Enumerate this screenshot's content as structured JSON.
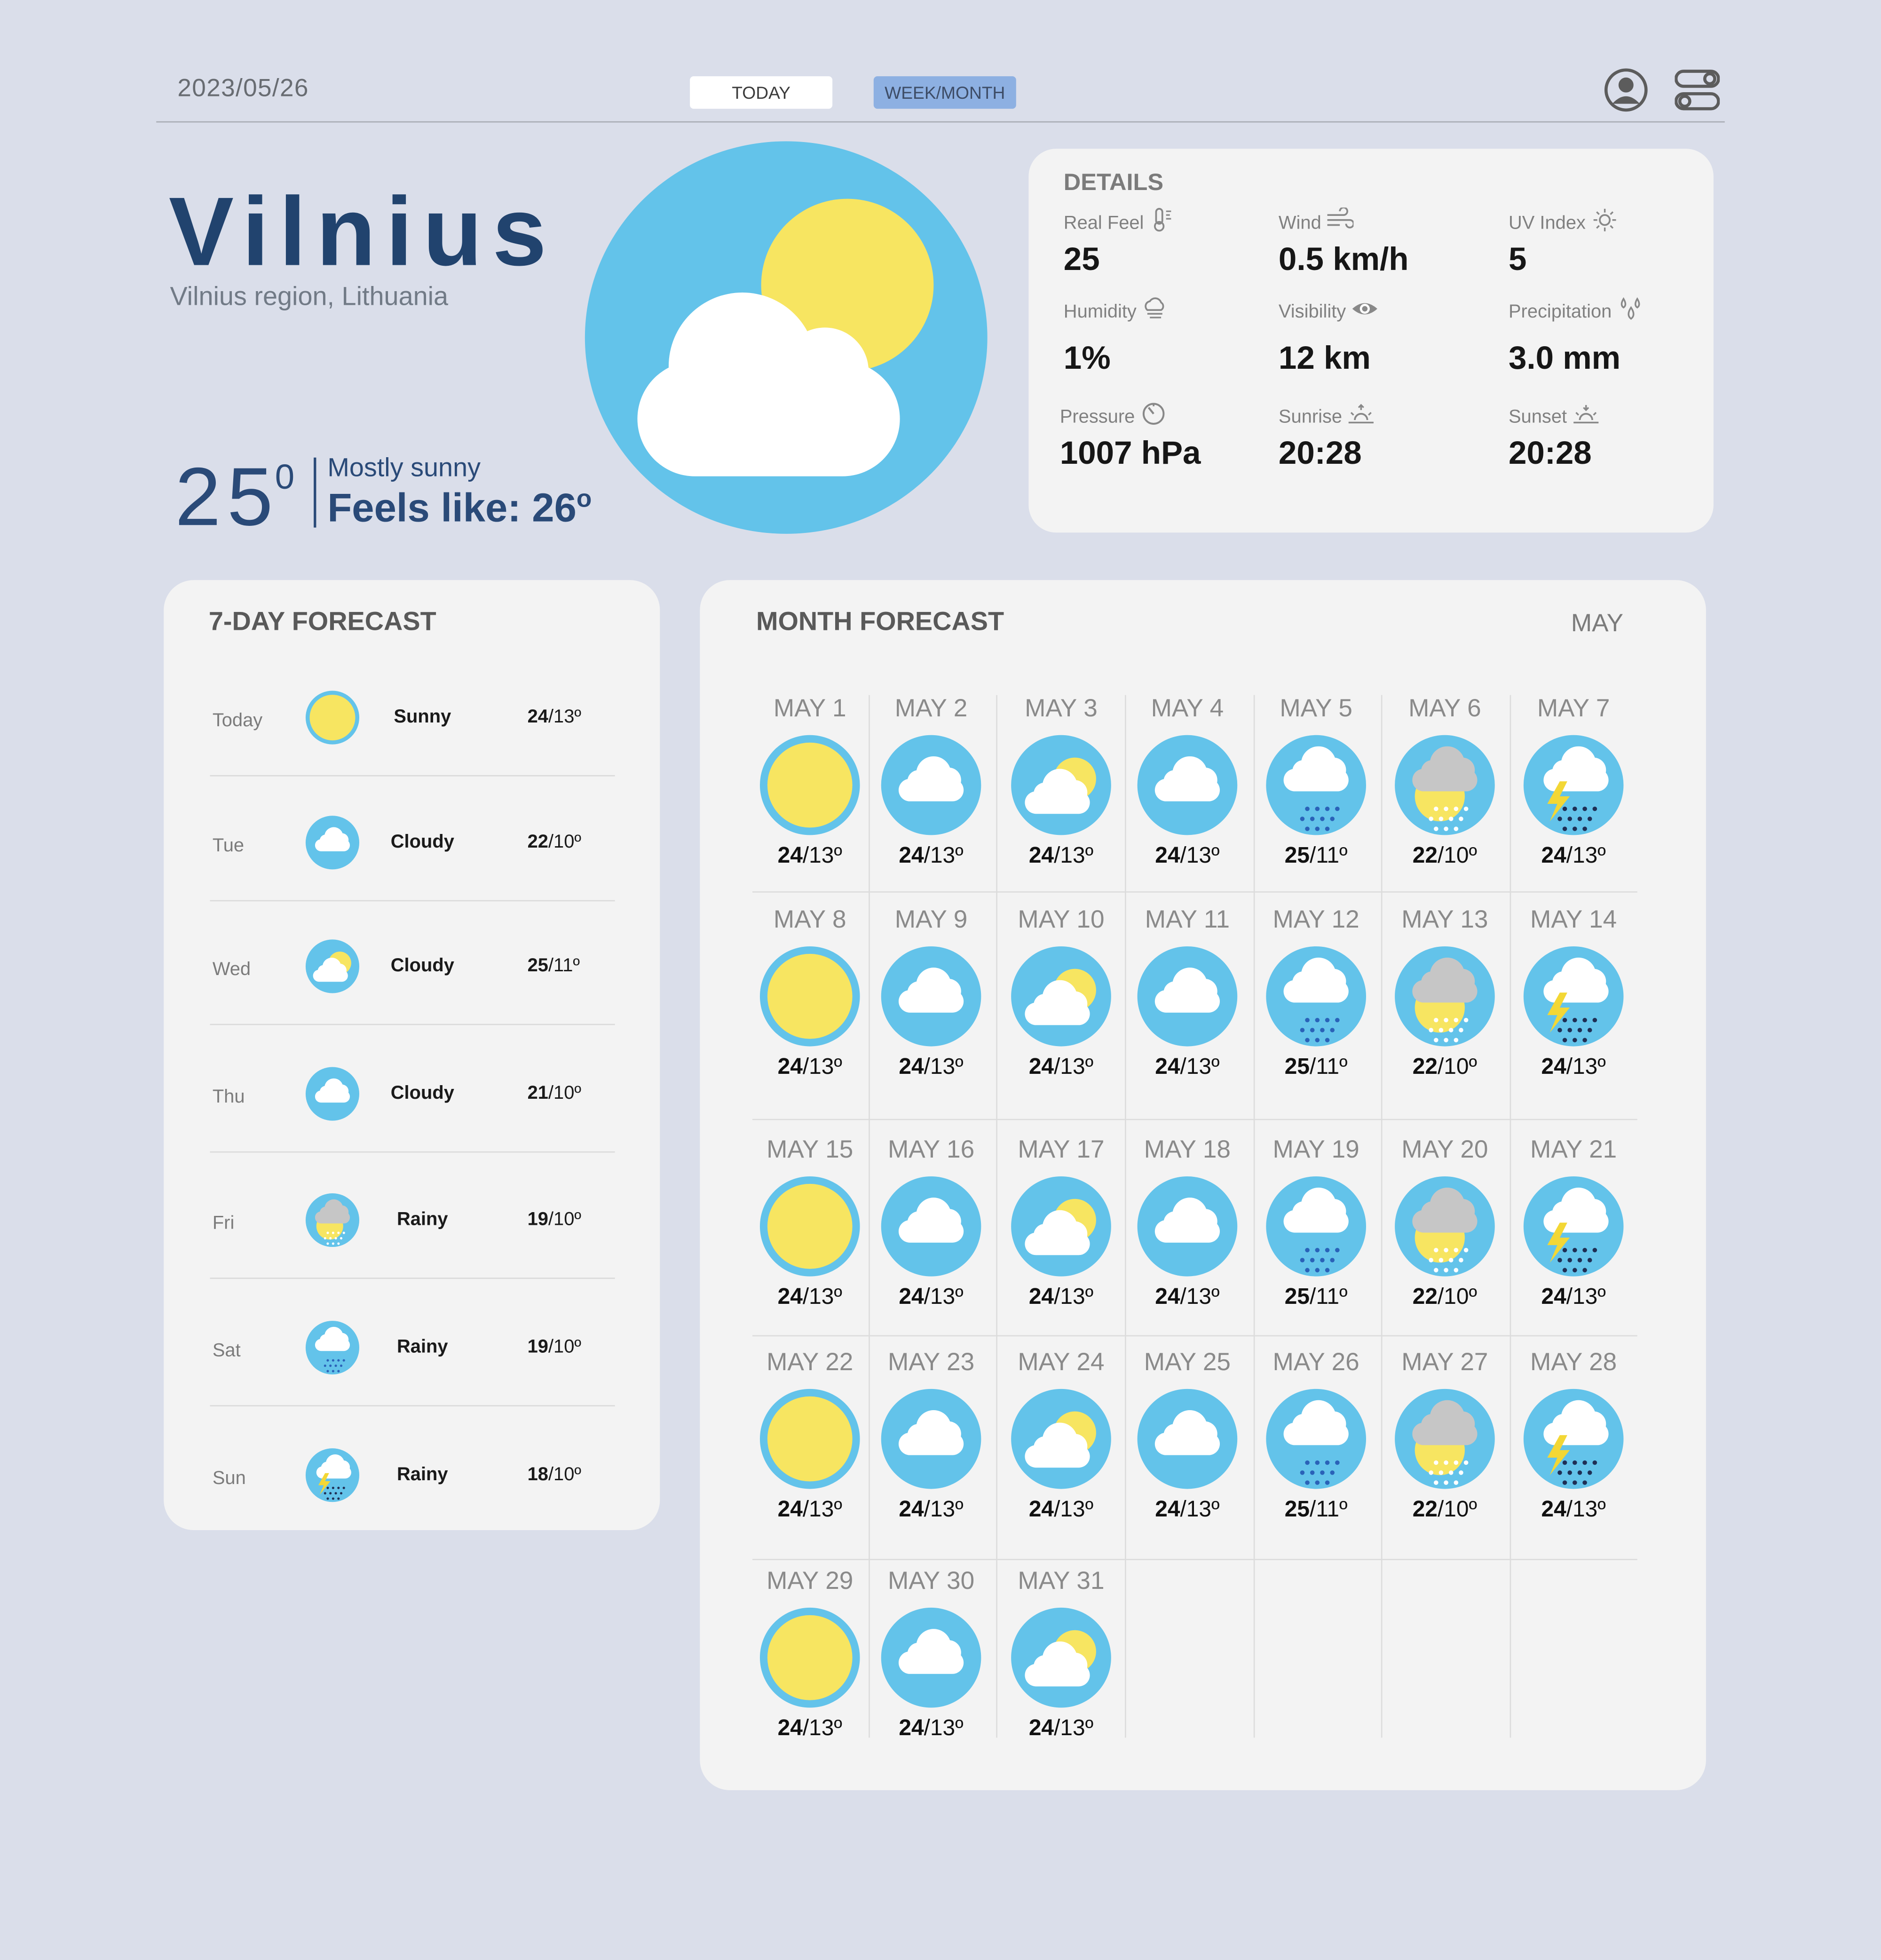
{
  "header": {
    "date": "2023/05/26",
    "tab_today": "TODAY",
    "tab_week_month": "WEEK/MONTH"
  },
  "location": {
    "city": "Vilnius",
    "region": "Vilnius region, Lithuania"
  },
  "current": {
    "temp": "25",
    "deg": "0",
    "condition": "Mostly sunny",
    "feels_like": "Feels like: 26",
    "feels_deg": "o",
    "icon": "partly-sunny-icon"
  },
  "details": {
    "title": "DETAILS",
    "items": [
      {
        "label": "Real Feel",
        "value": "25",
        "icon": "thermometer-icon"
      },
      {
        "label": "Wind",
        "value": "0.5 km/h",
        "icon": "wind-icon"
      },
      {
        "label": "UV Index",
        "value": "5",
        "icon": "sun-icon"
      },
      {
        "label": "Humidity",
        "value": "1%",
        "icon": "humidity-icon"
      },
      {
        "label": "Visibility",
        "value": "12 km",
        "icon": "eye-icon"
      },
      {
        "label": "Precipitation",
        "value": "3.0 mm",
        "icon": "drops-icon"
      },
      {
        "label": "Pressure",
        "value": "1007 hPa",
        "icon": "gauge-icon"
      },
      {
        "label": "Sunrise",
        "value": "20:28",
        "icon": "sunrise-icon"
      },
      {
        "label": "Sunset",
        "value": "20:28",
        "icon": "sunset-icon"
      }
    ]
  },
  "week": {
    "title": "7-DAY FORECAST",
    "days": [
      {
        "day": "Today",
        "condition": "Sunny",
        "hi": "24",
        "lo": "/13º",
        "icon": "sunny"
      },
      {
        "day": "Tue",
        "condition": "Cloudy",
        "hi": "22",
        "lo": "/10º",
        "icon": "cloudy"
      },
      {
        "day": "Wed",
        "condition": "Cloudy",
        "hi": "25",
        "lo": "/11º",
        "icon": "partly"
      },
      {
        "day": "Thu",
        "condition": "Cloudy",
        "hi": "21",
        "lo": "/10º",
        "icon": "cloudy"
      },
      {
        "day": "Fri",
        "condition": "Rainy",
        "hi": "19",
        "lo": "/10º",
        "icon": "sun-rain"
      },
      {
        "day": "Sat",
        "condition": "Rainy",
        "hi": "19",
        "lo": "/10º",
        "icon": "rain"
      },
      {
        "day": "Sun",
        "condition": "Rainy",
        "hi": "18",
        "lo": "/10º",
        "icon": "storm"
      }
    ]
  },
  "month": {
    "title": "MONTH FORECAST",
    "label": "MAY",
    "days": [
      {
        "date": "MAY 1",
        "hi": "24",
        "lo": "/13º",
        "icon": "sunny"
      },
      {
        "date": "MAY 2",
        "hi": "24",
        "lo": "/13º",
        "icon": "cloudy"
      },
      {
        "date": "MAY 3",
        "hi": "24",
        "lo": "/13º",
        "icon": "partly"
      },
      {
        "date": "MAY 4",
        "hi": "24",
        "lo": "/13º",
        "icon": "cloudy"
      },
      {
        "date": "MAY 5",
        "hi": "25",
        "lo": "/11º",
        "icon": "rain"
      },
      {
        "date": "MAY 6",
        "hi": "22",
        "lo": "/10º",
        "icon": "sun-rain"
      },
      {
        "date": "MAY 7",
        "hi": "24",
        "lo": "/13º",
        "icon": "storm"
      },
      {
        "date": "MAY 8",
        "hi": "24",
        "lo": "/13º",
        "icon": "sunny"
      },
      {
        "date": "MAY 9",
        "hi": "24",
        "lo": "/13º",
        "icon": "cloudy"
      },
      {
        "date": "MAY 10",
        "hi": "24",
        "lo": "/13º",
        "icon": "partly"
      },
      {
        "date": "MAY 11",
        "hi": "24",
        "lo": "/13º",
        "icon": "cloudy"
      },
      {
        "date": "MAY 12",
        "hi": "25",
        "lo": "/11º",
        "icon": "rain"
      },
      {
        "date": "MAY 13",
        "hi": "22",
        "lo": "/10º",
        "icon": "sun-rain"
      },
      {
        "date": "MAY 14",
        "hi": "24",
        "lo": "/13º",
        "icon": "storm"
      },
      {
        "date": "MAY 15",
        "hi": "24",
        "lo": "/13º",
        "icon": "sunny"
      },
      {
        "date": "MAY 16",
        "hi": "24",
        "lo": "/13º",
        "icon": "cloudy"
      },
      {
        "date": "MAY 17",
        "hi": "24",
        "lo": "/13º",
        "icon": "partly"
      },
      {
        "date": "MAY 18",
        "hi": "24",
        "lo": "/13º",
        "icon": "cloudy"
      },
      {
        "date": "MAY 19",
        "hi": "25",
        "lo": "/11º",
        "icon": "rain"
      },
      {
        "date": "MAY 20",
        "hi": "22",
        "lo": "/10º",
        "icon": "sun-rain"
      },
      {
        "date": "MAY 21",
        "hi": "24",
        "lo": "/13º",
        "icon": "storm"
      },
      {
        "date": "MAY 22",
        "hi": "24",
        "lo": "/13º",
        "icon": "sunny"
      },
      {
        "date": "MAY 23",
        "hi": "24",
        "lo": "/13º",
        "icon": "cloudy"
      },
      {
        "date": "MAY 24",
        "hi": "24",
        "lo": "/13º",
        "icon": "partly"
      },
      {
        "date": "MAY 25",
        "hi": "24",
        "lo": "/13º",
        "icon": "cloudy"
      },
      {
        "date": "MAY 26",
        "hi": "25",
        "lo": "/11º",
        "icon": "rain"
      },
      {
        "date": "MAY 27",
        "hi": "22",
        "lo": "/10º",
        "icon": "sun-rain"
      },
      {
        "date": "MAY 28",
        "hi": "24",
        "lo": "/13º",
        "icon": "storm"
      },
      {
        "date": "MAY 29",
        "hi": "24",
        "lo": "/13º",
        "icon": "sunny"
      },
      {
        "date": "MAY 30",
        "hi": "24",
        "lo": "/13º",
        "icon": "cloudy"
      },
      {
        "date": "MAY 31",
        "hi": "24",
        "lo": "/13º",
        "icon": "partly"
      }
    ]
  },
  "colors": {
    "background": "#dadeea",
    "card": "#f3f3f3",
    "accent_blue": "#63c3ea",
    "sun_yellow": "#f7e561",
    "title_navy": "#21436e",
    "tab_active": "#8db0e2"
  }
}
